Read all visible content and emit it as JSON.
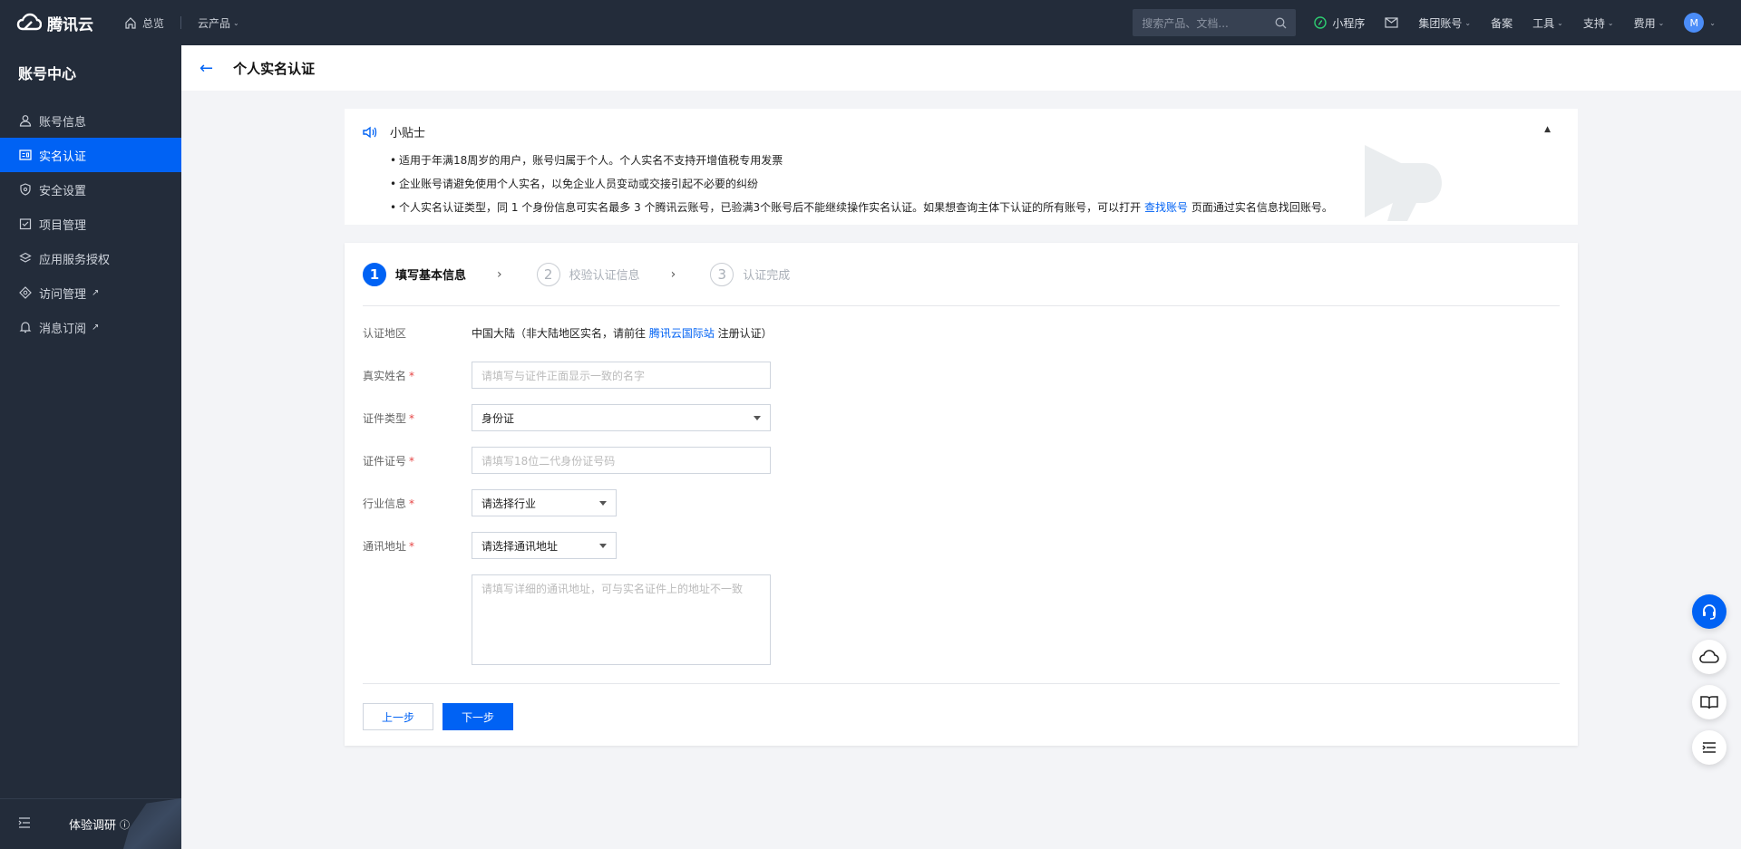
{
  "topbar": {
    "brand": "腾讯云",
    "overview": "总览",
    "products": "云产品",
    "search_placeholder": "搜索产品、文档...",
    "mini_program": "小程序",
    "group_account": "集团账号",
    "filing": "备案",
    "tools": "工具",
    "support": "支持",
    "billing": "费用",
    "avatar_letter": "M"
  },
  "sidebar": {
    "title": "账号中心",
    "items": [
      {
        "label": "账号信息"
      },
      {
        "label": "实名认证"
      },
      {
        "label": "安全设置"
      },
      {
        "label": "项目管理"
      },
      {
        "label": "应用服务授权"
      },
      {
        "label": "访问管理"
      },
      {
        "label": "消息订阅"
      }
    ],
    "active_index": 1,
    "survey": "体验调研"
  },
  "page": {
    "title": "个人实名认证"
  },
  "tips": {
    "title": "小贴士",
    "line1": "适用于年满18周岁的用户，账号归属于个人。个人实名不支持开增值税专用发票",
    "line2": "企业账号请避免使用个人实名，以免企业人员变动或交接引起不必要的纠纷",
    "line3_pre": "个人实名认证类型，同 1 个身份信息可实名最多 3 个腾讯云账号，已验满3个账号后不能继续操作实名认证。如果想查询主体下认证的所有账号，可以打开 ",
    "line3_link": "查找账号",
    "line3_post": " 页面通过实名信息找回账号。"
  },
  "steps": [
    {
      "num": "1",
      "label": "填写基本信息"
    },
    {
      "num": "2",
      "label": "校验认证信息"
    },
    {
      "num": "3",
      "label": "认证完成"
    }
  ],
  "form": {
    "region_label": "认证地区",
    "region_pre": "中国大陆（非大陆地区实名，请前往 ",
    "region_link": "腾讯云国际站",
    "region_post": " 注册认证）",
    "name_label": "真实姓名",
    "name_placeholder": "请填写与证件正面显示一致的名字",
    "idtype_label": "证件类型",
    "idtype_value": "身份证",
    "idnum_label": "证件证号",
    "idnum_placeholder": "请填写18位二代身份证号码",
    "industry_label": "行业信息",
    "industry_value": "请选择行业",
    "address_label": "通讯地址",
    "address_value": "请选择通讯地址",
    "address_detail_placeholder": "请填写详细的通讯地址，可与实名证件上的地址不一致"
  },
  "buttons": {
    "prev": "上一步",
    "next": "下一步"
  },
  "colors": {
    "brand": "#0062f4",
    "topbar": "#232c3a"
  }
}
